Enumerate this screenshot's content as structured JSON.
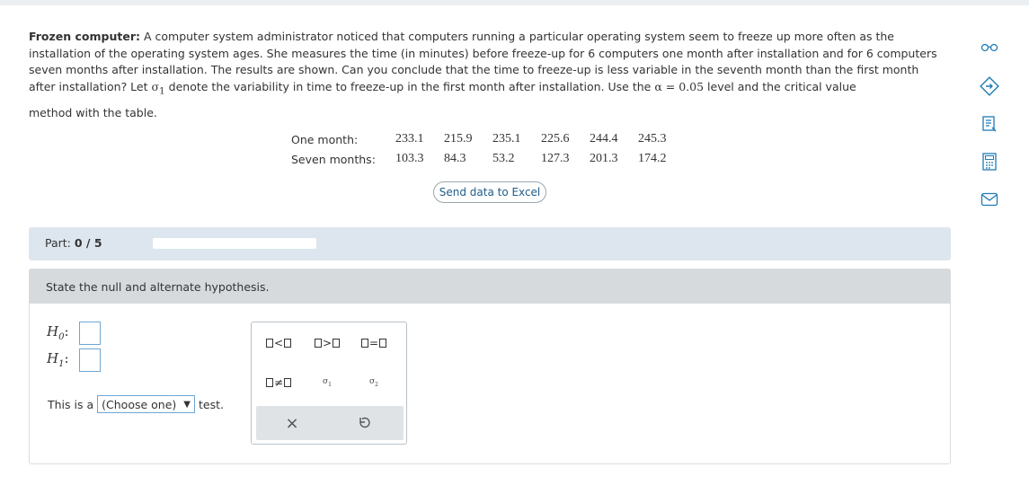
{
  "problem": {
    "title": "Frozen computer",
    "text": "A computer system administrator noticed that computers running a particular operating system seem to freeze up more often as the installation of the operating system ages. She measures the time (in minutes) before freeze-up for 6 computers one month after installation and for 6 computers seven months after installation. The results are shown. Can you conclude that the time to freeze-up is less variable in the seventh month than the first month after installation? Let",
    "sigma_symbol": "σ",
    "sigma_sub": "1",
    "text_after_sigma": "denote the variability in time to freeze-up in the first month after installation. Use the",
    "alpha_expr": "α = 0.05",
    "text_after_alpha": "level and the critical value",
    "method_line": "method with the table."
  },
  "data_table": {
    "rows": [
      {
        "label": "One month:",
        "values": [
          "233.1",
          "215.9",
          "235.1",
          "225.6",
          "244.4",
          "245.3"
        ]
      },
      {
        "label": "Seven months:",
        "values": [
          "103.3",
          "84.3",
          "53.2",
          "127.3",
          "201.3",
          "174.2"
        ]
      }
    ]
  },
  "excel_button": {
    "label": "Send data to Excel"
  },
  "part": {
    "label": "Part:",
    "value": "0 / 5",
    "progress_fraction": 0.0
  },
  "question": {
    "prompt": "State the null and alternate hypothesis.",
    "h0_letter": "H",
    "h0_sub": "0",
    "h1_letter": "H",
    "h1_sub": "1",
    "colon": ":",
    "test_prefix": "This is a",
    "test_select_value": "(Choose one)",
    "test_suffix": "test."
  },
  "palette": {
    "ops": [
      "<",
      ">",
      "=",
      "≠"
    ],
    "sigma1": "σ",
    "sigma1_sub": "1",
    "sigma2": "σ",
    "sigma2_sub": "2",
    "clear_symbol": "×",
    "undo_symbol": "↺"
  },
  "side_tools": [
    "glasses-icon",
    "help-icon",
    "notes-icon",
    "calculator-icon",
    "mail-icon"
  ],
  "colors": {
    "accent": "#3b8ec8",
    "link": "#1f5c8a",
    "part_bg": "#dde6ee",
    "header_bg": "#d6dadc",
    "side_icon": "#1f7bb5"
  }
}
